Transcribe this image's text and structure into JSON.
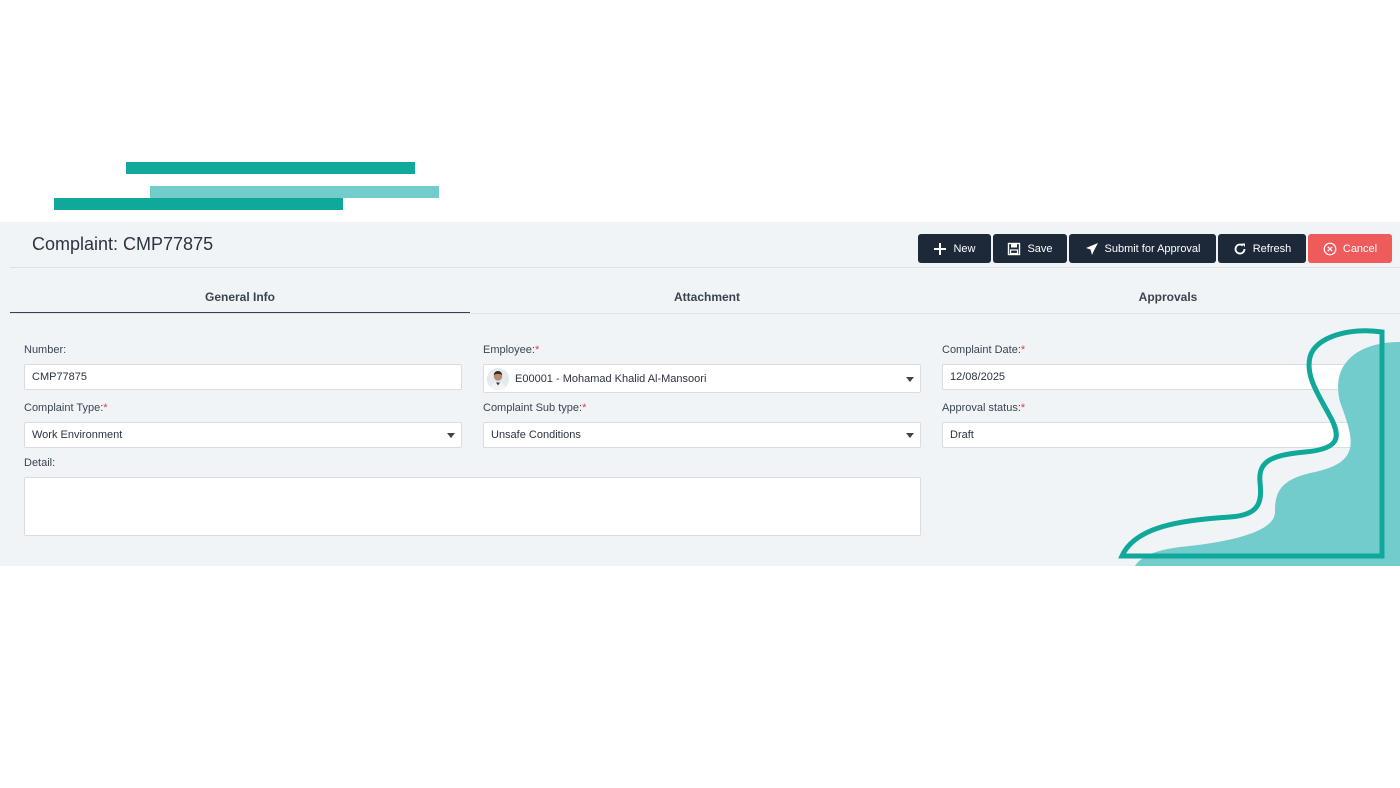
{
  "header": {
    "title": "Complaint: CMP77875"
  },
  "toolbar": {
    "new_label": "New",
    "save_label": "Save",
    "submit_label": "Submit for Approval",
    "refresh_label": "Refresh",
    "cancel_label": "Cancel"
  },
  "tabs": [
    {
      "label": "General Info",
      "active": true
    },
    {
      "label": "Attachment",
      "active": false
    },
    {
      "label": "Approvals",
      "active": false
    }
  ],
  "form": {
    "number": {
      "label": "Number:",
      "value": "CMP77875"
    },
    "employee": {
      "label": "Employee:",
      "required": "*",
      "value": "E00001 - Mohamad Khalid Al-Mansoori"
    },
    "complaint_date": {
      "label": "Complaint Date:",
      "required": "*",
      "value": "12/08/2025"
    },
    "complaint_type": {
      "label": "Complaint Type:",
      "required": "*",
      "value": "Work Environment"
    },
    "complaint_sub_type": {
      "label": "Complaint Sub type:",
      "required": "*",
      "value": "Unsafe Conditions"
    },
    "approval_status": {
      "label": "Approval status:",
      "required": "*",
      "value": "Draft"
    },
    "detail": {
      "label": "Detail:",
      "value": ""
    }
  },
  "colors": {
    "toolbar_button": "#1d2939",
    "cancel_button": "#ef5a5a",
    "teal": "#0fa89a",
    "teal_light": "#72cccb"
  }
}
